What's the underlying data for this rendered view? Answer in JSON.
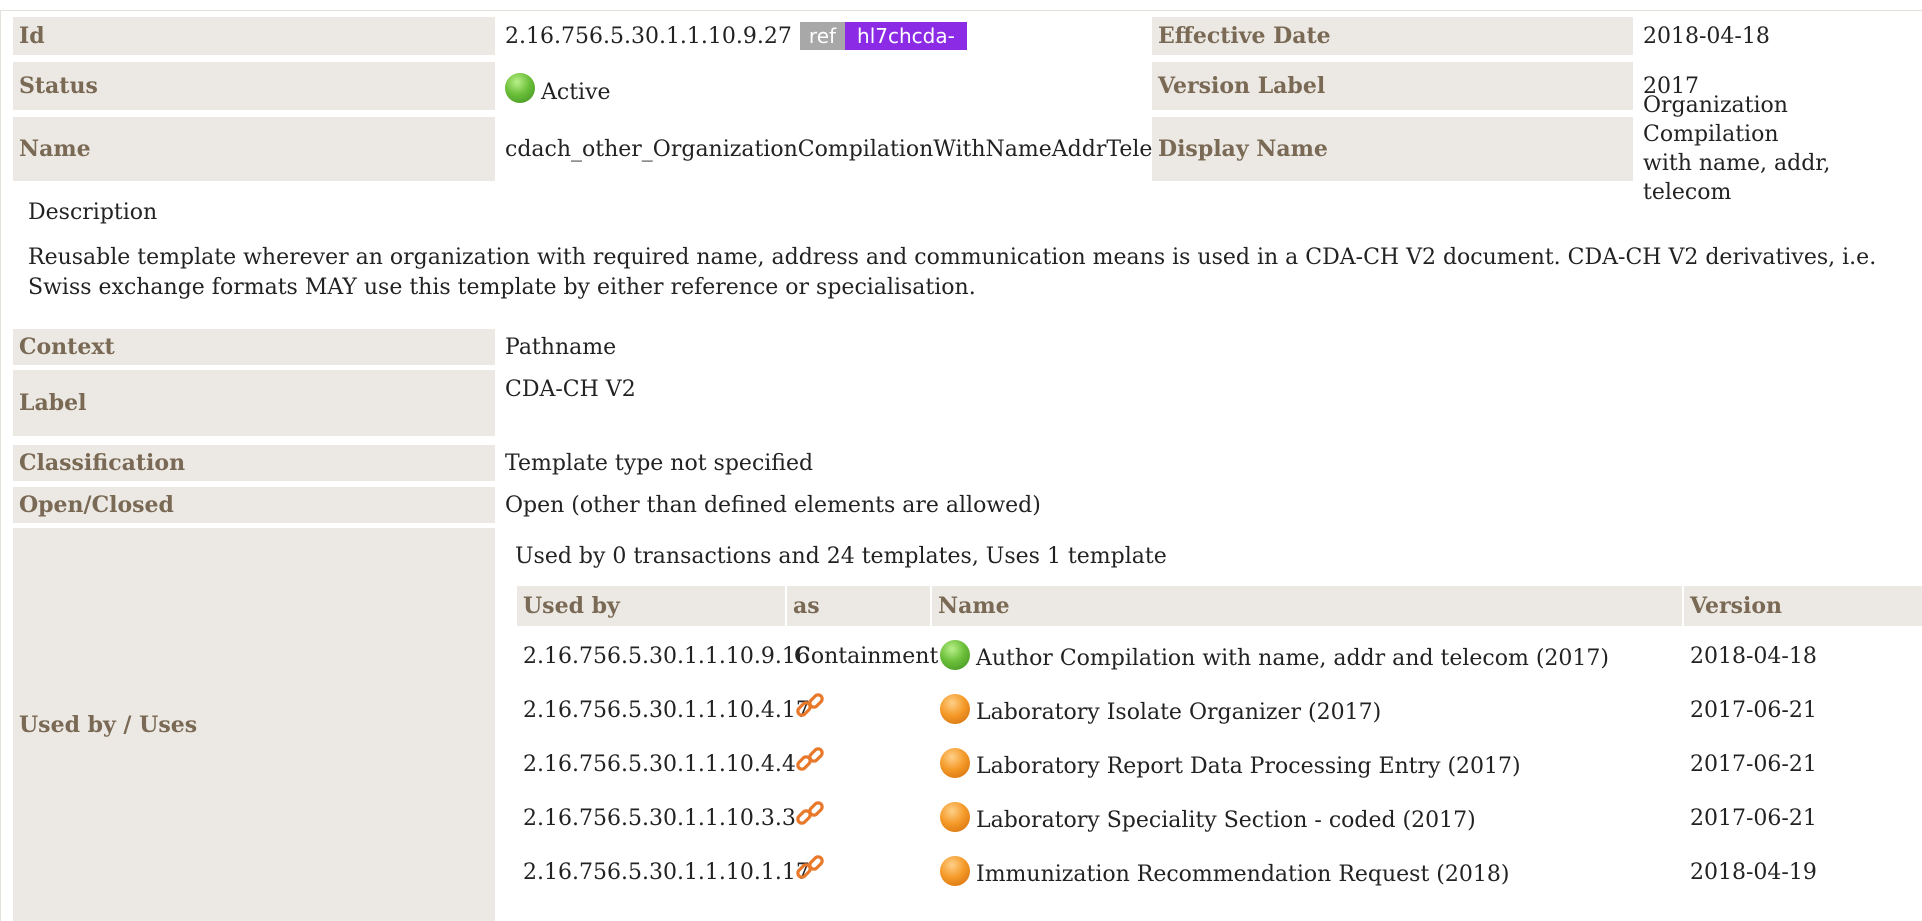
{
  "colors": {
    "label_bg": "#ece9e4",
    "label_text": "#7a6a55",
    "prefix_badge": "#8c2be6",
    "ref_badge": "#a8a8a8"
  },
  "summary": {
    "id_label": "Id",
    "id_value": "2.16.756.5.30.1.1.10.9.27",
    "ref_badge": "ref",
    "prefix_badge": "hl7chcda-",
    "effective_date_label": "Effective Date",
    "effective_date_value": "2018-04-18",
    "status_label": "Status",
    "status_value": "Active",
    "version_label_label": "Version Label",
    "version_label_value": "2017",
    "name_label": "Name",
    "name_value": "cdach_other_OrganizationCompilationWithNameAddrTelecom",
    "display_name_label": "Display Name",
    "display_name_value_line1": "Organization Compilation",
    "display_name_value_line2": "with name, addr, telecom"
  },
  "description": {
    "title": "Description",
    "text": "Reusable template wherever an organization with required name, address and communication means is used in a CDA-CH V2 document. CDA-CH V2 derivatives, i.e. Swiss exchange formats MAY use this template by either reference or specialisation."
  },
  "details": {
    "context_label": "Context",
    "context_value": "Pathname",
    "label_label": "Label",
    "label_value": "CDA-CH V2",
    "classification_label": "Classification",
    "classification_value": "Template type not specified",
    "open_closed_label": "Open/Closed",
    "open_closed_value": "Open (other than defined elements are allowed)",
    "used_by_label": "Used by / Uses",
    "used_by_summary": "Used by 0 transactions and 24 templates, Uses 1 template"
  },
  "usage_table": {
    "headers": [
      "Used by",
      "as",
      "Name",
      "Version"
    ],
    "rows": [
      {
        "id": "2.16.756.5.30.1.1.10.9.16",
        "as": "Containment",
        "status_icon": "green-status-icon",
        "name": "Author Compilation with name, addr and telecom (2017)",
        "version": "2018-04-18"
      },
      {
        "id": "2.16.756.5.30.1.1.10.4.17",
        "as": "",
        "as_icon": "link-icon",
        "status_icon": "orange-status-icon",
        "name": "Laboratory Isolate Organizer (2017)",
        "version": "2017-06-21"
      },
      {
        "id": "2.16.756.5.30.1.1.10.4.4",
        "as": "",
        "as_icon": "link-icon",
        "status_icon": "orange-status-icon",
        "name": "Laboratory Report Data Processing Entry (2017)",
        "version": "2017-06-21"
      },
      {
        "id": "2.16.756.5.30.1.1.10.3.3",
        "as": "",
        "as_icon": "link-icon",
        "status_icon": "orange-status-icon",
        "name": "Laboratory Speciality Section - coded (2017)",
        "version": "2017-06-21"
      },
      {
        "id": "2.16.756.5.30.1.1.10.1.17",
        "as": "",
        "as_icon": "link-icon",
        "status_icon": "orange-status-icon",
        "name": "Immunization Recommendation Request (2018)",
        "version": "2018-04-19"
      }
    ]
  }
}
